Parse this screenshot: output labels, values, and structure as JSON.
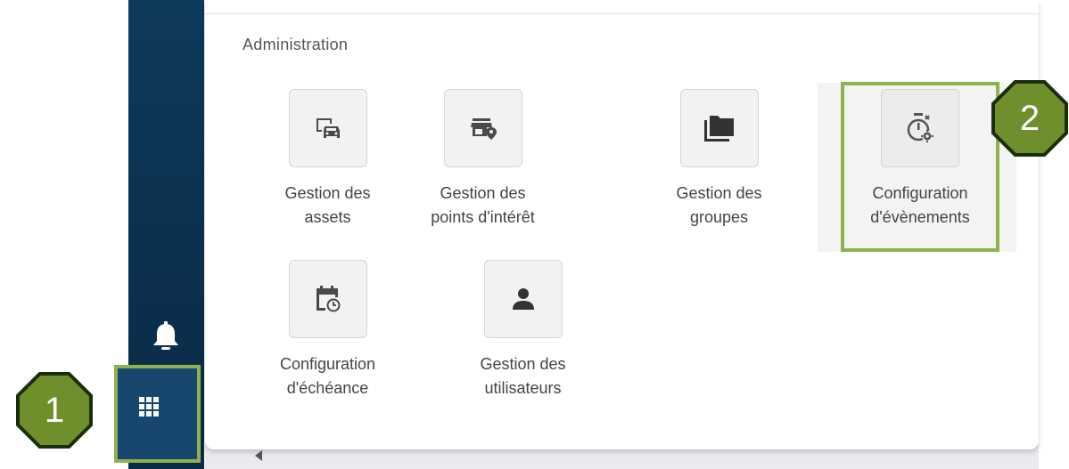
{
  "panel": {
    "section_title": "Administration",
    "tiles": [
      {
        "label_line1": "Gestion des",
        "label_line2": "assets",
        "icon": "vehicle-assets-icon"
      },
      {
        "label_line1": "Gestion des",
        "label_line2": "points d'intérêt",
        "icon": "store-location-icon"
      },
      {
        "label_line1": "Gestion des",
        "label_line2": "groupes",
        "icon": "folders-icon"
      },
      {
        "label_line1": "Configuration",
        "label_line2": "d'évènements",
        "icon": "timer-settings-icon"
      },
      {
        "label_line1": "Configuration",
        "label_line2": "d'échéance",
        "icon": "calendar-clock-icon"
      },
      {
        "label_line1": "Gestion des",
        "label_line2": "utilisateurs",
        "icon": "user-icon"
      }
    ]
  },
  "sidebar": {
    "icons": [
      "bell-icon",
      "apps-grid-icon"
    ]
  },
  "callouts": {
    "one": "1",
    "two": "2"
  },
  "colors": {
    "sidebar": "#0b2f4d",
    "highlight": "#8fb24f",
    "callout_fill": "#6f8f2d"
  }
}
